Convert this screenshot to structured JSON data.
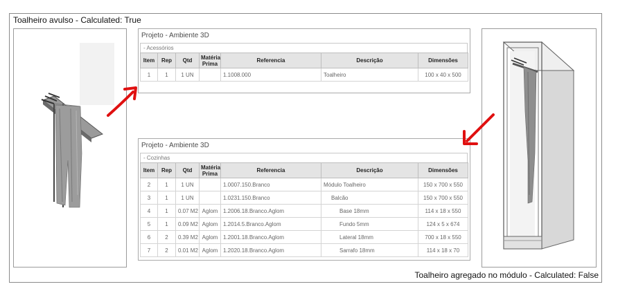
{
  "captions": {
    "top_left": "Toalheiro avulso - Calculated: True",
    "bottom_right": "Toalheiro agregado no módulo - Calculated: False"
  },
  "columns": [
    "Item",
    "Rep",
    "Qtd",
    "Matéria Prima",
    "Referencia",
    "Descrição",
    "Dimensões"
  ],
  "panel_accessories": {
    "title": "Projeto - Ambiente 3D",
    "section": "- Acessórios",
    "rows": [
      {
        "item": "1",
        "rep": "1",
        "qtd": "1 UN",
        "materia": "",
        "referencia": "1.1008.000",
        "descricao": "Toalheiro",
        "dimensoes": "100 x 40 x 500"
      }
    ]
  },
  "panel_kitchens": {
    "title": "Projeto - Ambiente 3D",
    "section": "- Cozinhas",
    "rows": [
      {
        "item": "2",
        "rep": "1",
        "qtd": "1 UN",
        "materia": "",
        "referencia": "1.0007.150.Branco",
        "descricao": "Módulo Toalheiro",
        "indent": 0,
        "dimensoes": "150 x 700 x 550"
      },
      {
        "item": "3",
        "rep": "1",
        "qtd": "1 UN",
        "materia": "",
        "referencia": "1.0231.150.Branco",
        "descricao": "Balcão",
        "indent": 1,
        "dimensoes": "150 x 700 x 550"
      },
      {
        "item": "4",
        "rep": "1",
        "qtd": "0.07 M2",
        "materia": "Aglom",
        "referencia": "1.2006.18.Branco.Aglom",
        "descricao": "Base 18mm",
        "indent": 2,
        "dimensoes": "114 x 18 x 550"
      },
      {
        "item": "5",
        "rep": "1",
        "qtd": "0.09 M2",
        "materia": "Aglom",
        "referencia": "1.2014.5.Branco.Aglom",
        "descricao": "Fundo 5mm",
        "indent": 2,
        "dimensoes": "124 x 5 x 674"
      },
      {
        "item": "6",
        "rep": "2",
        "qtd": "0.39 M2",
        "materia": "Aglom",
        "referencia": "1.2001.18.Branco.Aglom",
        "descricao": "Lateral 18mm",
        "indent": 2,
        "dimensoes": "700 x 18 x 550"
      },
      {
        "item": "7",
        "rep": "2",
        "qtd": "0.01 M2",
        "materia": "Aglom",
        "referencia": "1.2020.18.Branco.Aglom",
        "descricao": "Sarrafo 18mm",
        "indent": 2,
        "dimensoes": "114 x 18 x 70"
      }
    ]
  },
  "colors": {
    "arrow": "#e01010",
    "header_bg": "#e4e4e4",
    "border": "#a9a9a9"
  }
}
